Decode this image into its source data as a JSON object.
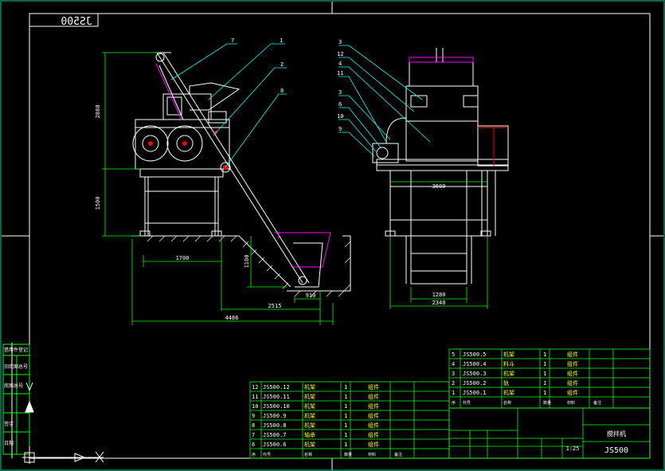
{
  "drawing": {
    "code_mirrored": "JS500",
    "title_code": "JS500",
    "main_title": "搅拌机",
    "scale": "1:25"
  },
  "side_view": {
    "callouts": [
      "7",
      "1",
      "2",
      "8"
    ],
    "dims": {
      "h_upper": "2880",
      "h_lower": "1500",
      "h_pit": "1100",
      "w_1700": "1700",
      "w_910": "910",
      "w_2515": "2515",
      "w_4486": "4486"
    }
  },
  "front_view": {
    "callouts": [
      "3",
      "12",
      "4",
      "11",
      "3",
      "6",
      "10",
      "9"
    ],
    "dims": {
      "w_3600": "3600",
      "w_1280": "1280",
      "w_2340": "2340"
    }
  },
  "bom_right": {
    "rows": [
      {
        "no": "5",
        "code": "JS500.5",
        "name": "机架",
        "qty": "1",
        "mat": "组件"
      },
      {
        "no": "4",
        "code": "JS500.4",
        "name": "料斗",
        "qty": "1",
        "mat": "组件"
      },
      {
        "no": "3",
        "code": "JS500.3",
        "name": "机架",
        "qty": "1",
        "mat": "组件"
      },
      {
        "no": "2",
        "code": "JS500.2",
        "name": "轨",
        "qty": "1",
        "mat": "组件"
      },
      {
        "no": "1",
        "code": "JS500.1",
        "name": "机架",
        "qty": "1",
        "mat": "组件"
      }
    ],
    "header": [
      "序",
      "代号",
      "名称",
      "数量",
      "材料",
      "备注"
    ]
  },
  "bom_left": {
    "rows": [
      {
        "no": "12",
        "code": "JS500.12",
        "name": "机架",
        "qty": "1",
        "mat": "组件"
      },
      {
        "no": "11",
        "code": "JS500.11",
        "name": "机架",
        "qty": "1",
        "mat": "组件"
      },
      {
        "no": "10",
        "code": "JS500.10",
        "name": "机架",
        "qty": "1",
        "mat": "组件"
      },
      {
        "no": "9",
        "code": "JS500.9",
        "name": "机架",
        "qty": "1",
        "mat": "组件"
      },
      {
        "no": "8",
        "code": "JS500.8",
        "name": "机架",
        "qty": "1",
        "mat": "组件"
      },
      {
        "no": "7",
        "code": "JS500.7",
        "name": "轴承",
        "qty": "1",
        "mat": "组件"
      },
      {
        "no": "6",
        "code": "JS500.6",
        "name": "机架",
        "qty": "1",
        "mat": "组件"
      }
    ],
    "header": [
      "序",
      "代号",
      "名称",
      "数量",
      "材料",
      "备注"
    ]
  },
  "left_strip": [
    "借用件登记",
    "旧底图总号",
    "底图总号",
    "签字",
    "日期"
  ],
  "colors": {
    "frame": "#ffffff",
    "body": "#ffffff",
    "dims": "#00ff00",
    "leaders": "#00ffff",
    "table_text": "#ffffff",
    "highlight": "#ffff00",
    "hopper": "#ff00ff",
    "red": "#ff0000",
    "table_lines": "#00ff00"
  }
}
